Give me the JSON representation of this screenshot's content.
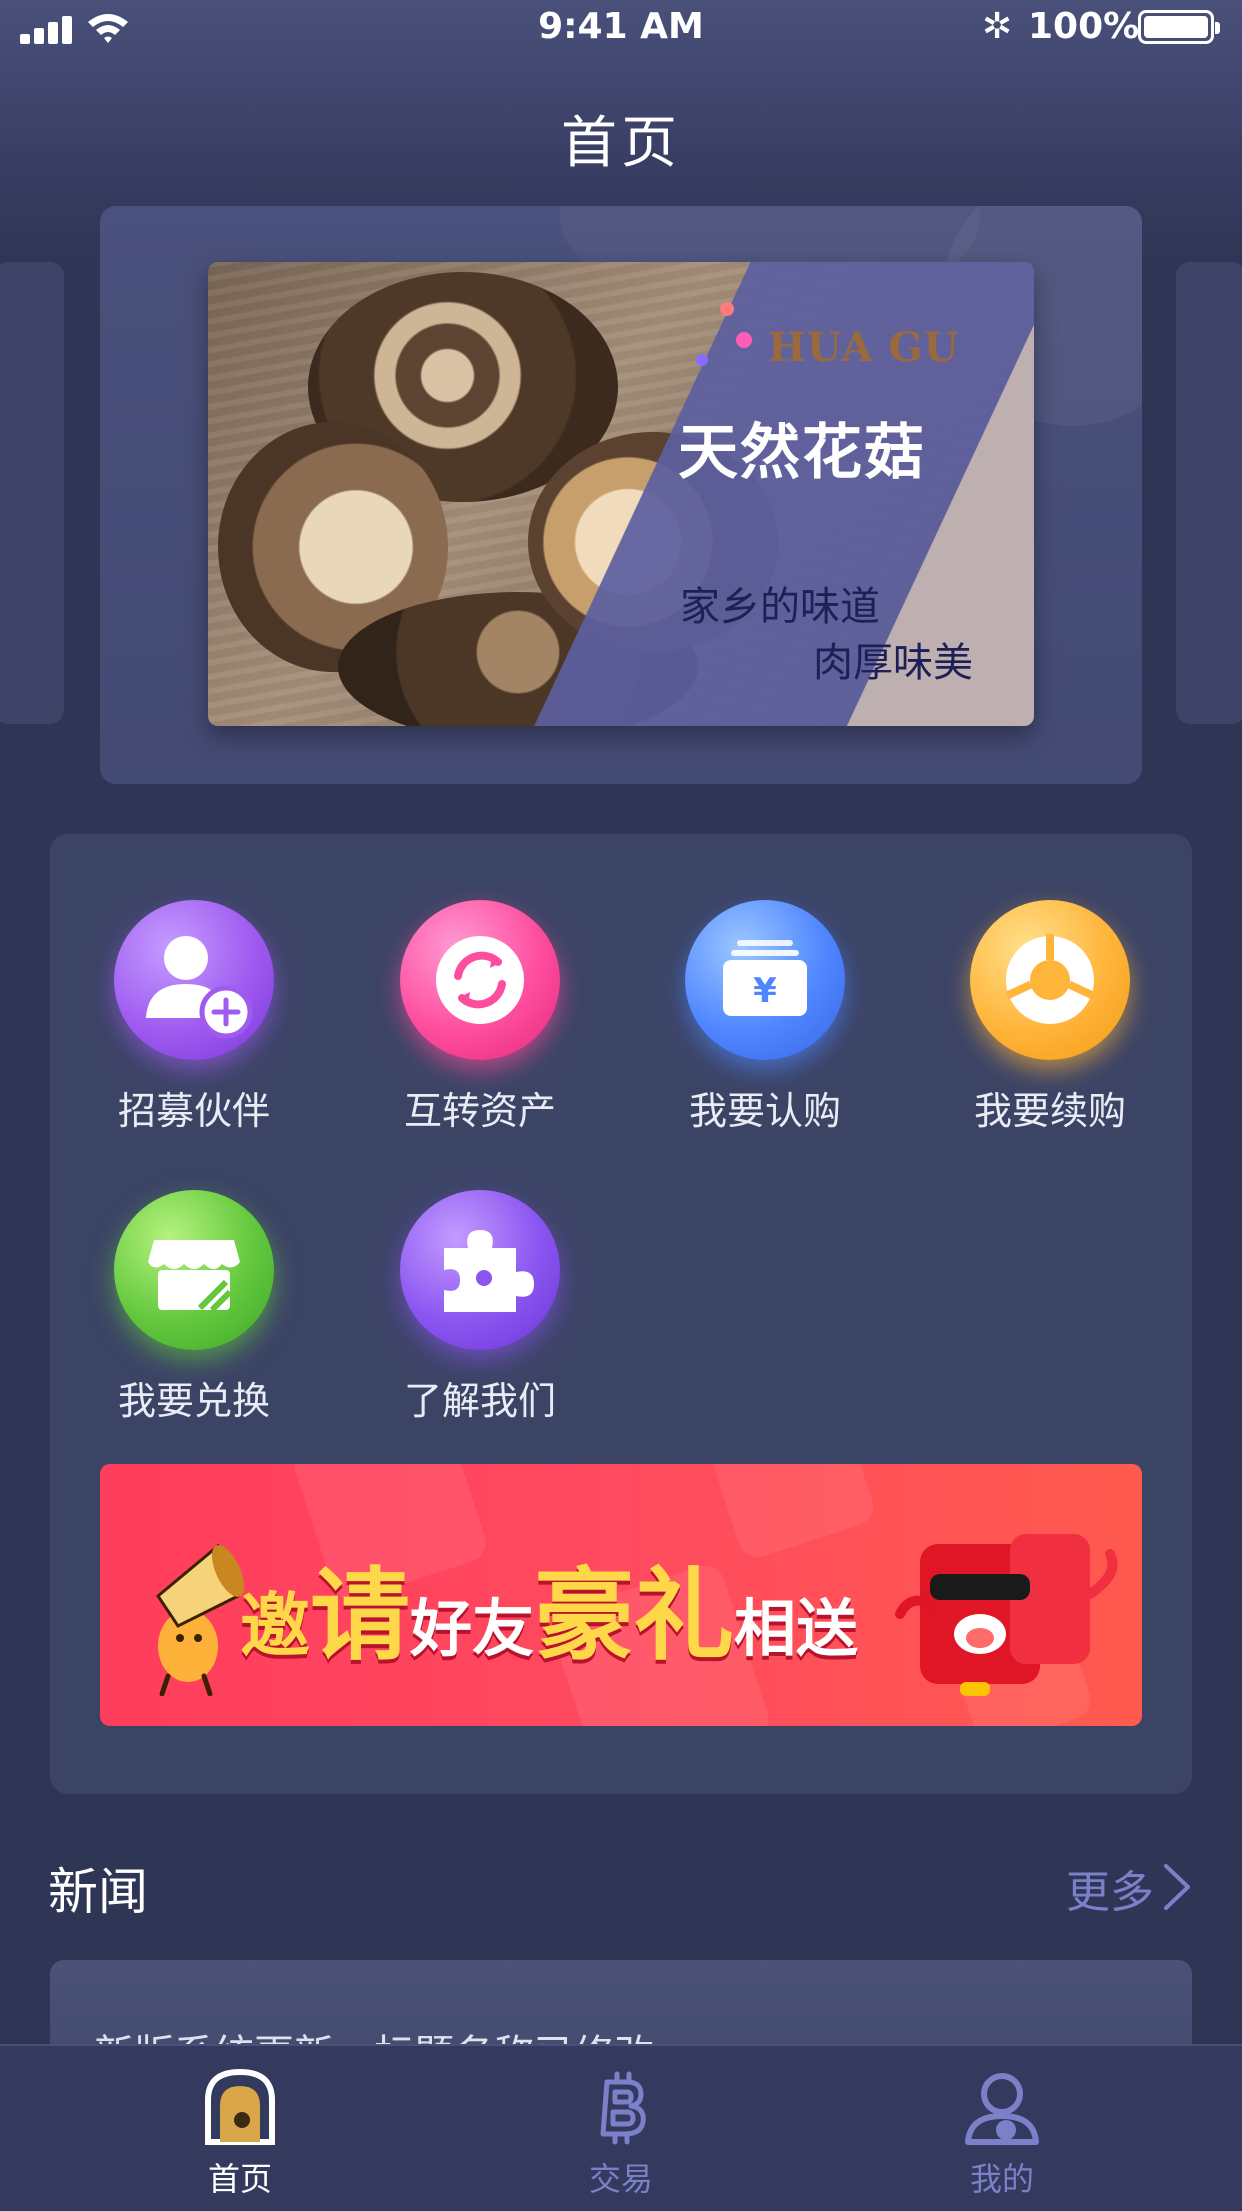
{
  "status_bar": {
    "time": "9:41 AM",
    "battery": "100%"
  },
  "header": {
    "title": "首页"
  },
  "carousel": {
    "banner": {
      "brand": "HUA GU",
      "headline": "天然花菇",
      "line1": "家乡的味道",
      "line2": "肉厚味美"
    }
  },
  "features": [
    {
      "label": "招募伙伴",
      "icon": "add-user-icon"
    },
    {
      "label": "互转资产",
      "icon": "transfer-icon"
    },
    {
      "label": "我要认购",
      "icon": "subscribe-icon"
    },
    {
      "label": "我要续购",
      "icon": "renew-icon"
    },
    {
      "label": "我要兑换",
      "icon": "store-icon"
    },
    {
      "label": "了解我们",
      "icon": "puzzle-icon"
    }
  ],
  "invite_banner": {
    "p1": "邀",
    "p2": "请",
    "p3": "好友",
    "p4": "豪礼",
    "p5": "相送"
  },
  "news": {
    "title": "新闻",
    "more": "更多",
    "items": [
      {
        "title": "新版系统更新，标题名称已修改"
      }
    ]
  },
  "tabbar": {
    "items": [
      {
        "label": "首页",
        "icon": "home-icon",
        "active": true
      },
      {
        "label": "交易",
        "icon": "bitcoin-icon",
        "active": false
      },
      {
        "label": "我的",
        "icon": "user-icon",
        "active": false
      }
    ]
  },
  "colors": {
    "background": "#2f3554",
    "panel": "#3c4466",
    "accent": "#7b80c9",
    "invite_red": "#ff4a5f",
    "invite_yellow": "#ffd84a"
  }
}
